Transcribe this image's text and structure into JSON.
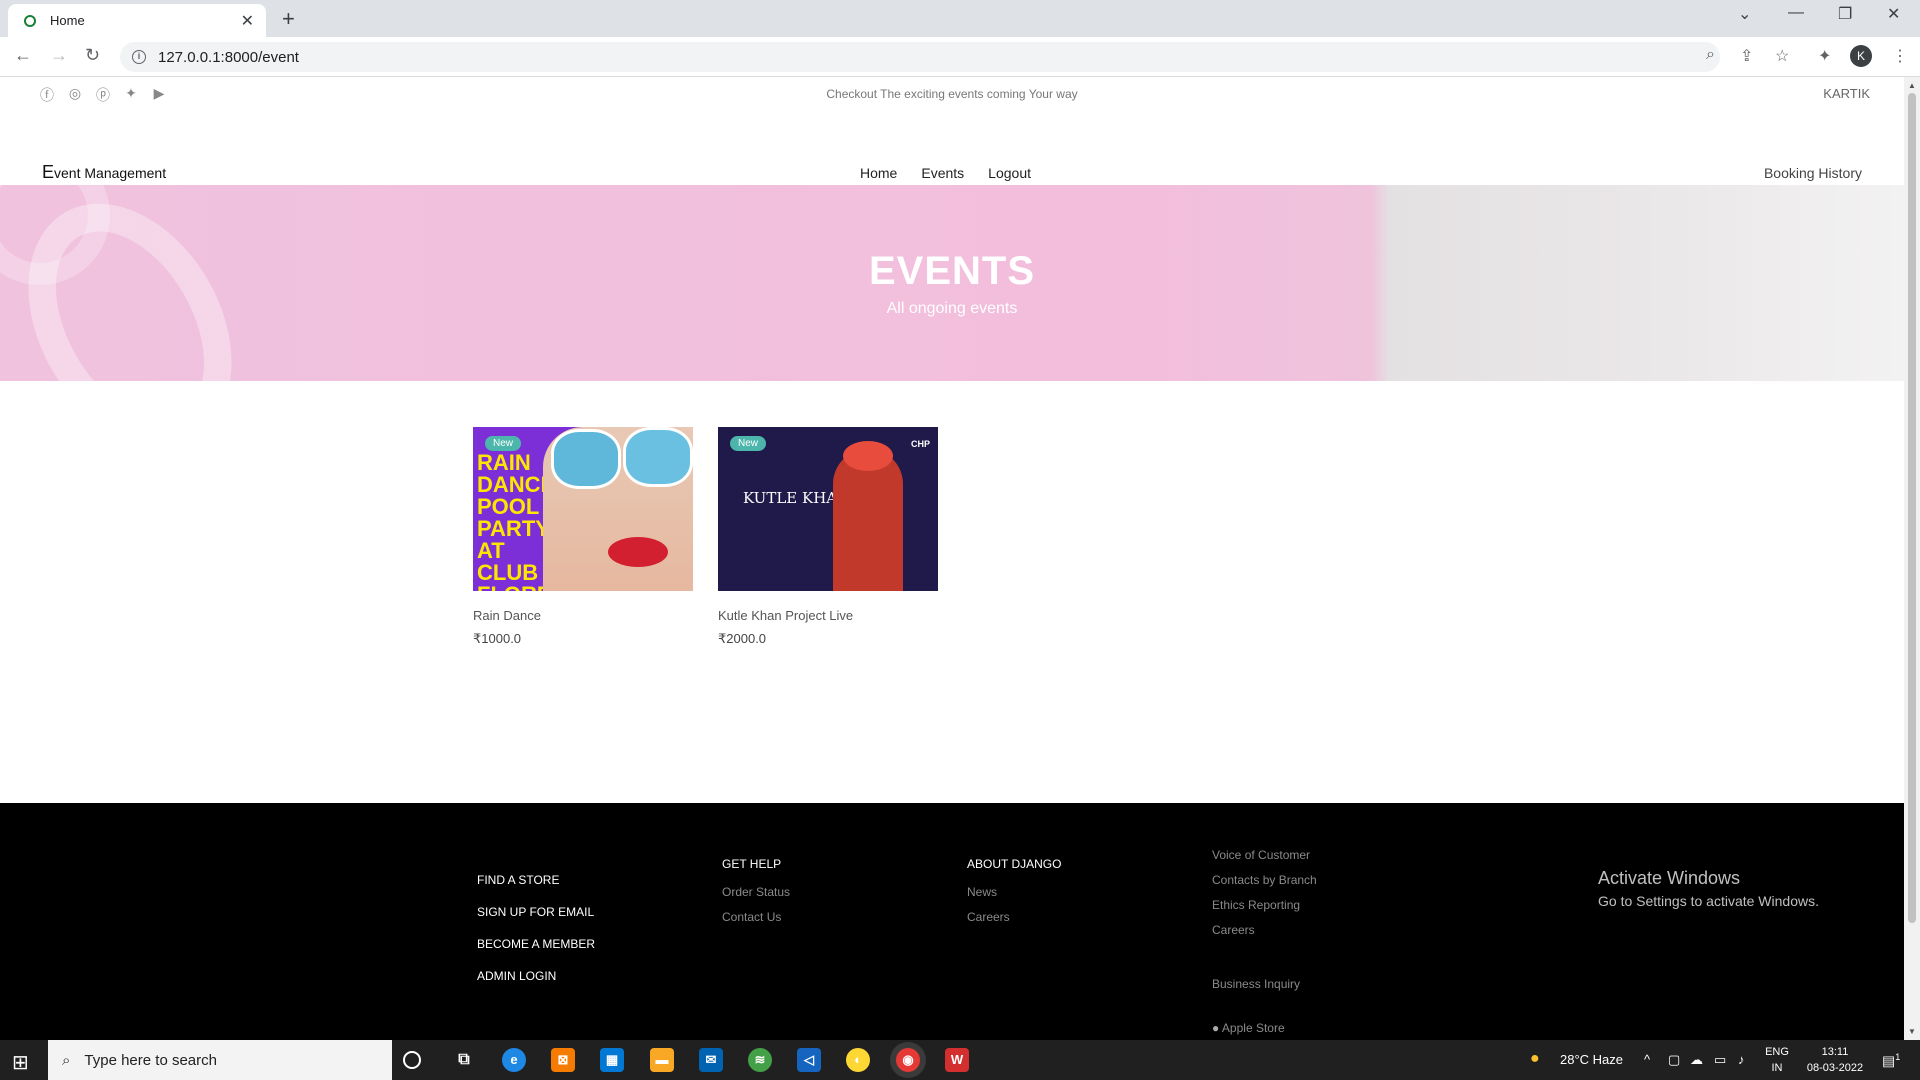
{
  "browser": {
    "tab_title": "Home",
    "new_tab": "+",
    "url": "127.0.0.1:8000/event",
    "profile_initial": "K"
  },
  "site": {
    "tagline": "Checkout The exciting events coming Your way",
    "username": "KARTIK",
    "brand_initial": "E",
    "brand_rest": "vent Management",
    "nav": [
      "Home",
      "Events",
      "Logout"
    ],
    "booking_history": "Booking History"
  },
  "hero": {
    "title": "EVENTS",
    "subtitle": "All ongoing events"
  },
  "events": [
    {
      "badge": "New",
      "name": "Rain Dance",
      "price": "₹1000.0",
      "poster_text": "RAIN DANCE POOL PARTY AT CLUB FLORENCE"
    },
    {
      "badge": "New",
      "name": "Kutle Khan Project Live",
      "price": "₹2000.0",
      "poster_text": "KUTLE KHAN",
      "poster_mark": "CHP"
    }
  ],
  "footer": {
    "col1": [
      "FIND A STORE",
      "SIGN UP FOR EMAIL",
      "BECOME A MEMBER",
      "ADMIN LOGIN"
    ],
    "col2": {
      "head": "GET HELP",
      "links": [
        "Order Status",
        "Contact Us"
      ]
    },
    "col3": {
      "head": "ABOUT DJANGO",
      "links": [
        "News",
        "Careers"
      ]
    },
    "col4": [
      "Voice of Customer",
      "Contacts by Branch",
      "Ethics Reporting",
      "Careers"
    ],
    "business": "Business Inquiry",
    "apple": "Apple Store"
  },
  "watermark": {
    "line1": "Activate Windows",
    "line2": "Go to Settings to activate Windows."
  },
  "taskbar": {
    "search_placeholder": "Type here to search",
    "weather": "28°C  Haze",
    "lang1": "ENG",
    "lang2": "IN",
    "time": "13:11",
    "date": "08-03-2022",
    "notif_count": "1"
  }
}
